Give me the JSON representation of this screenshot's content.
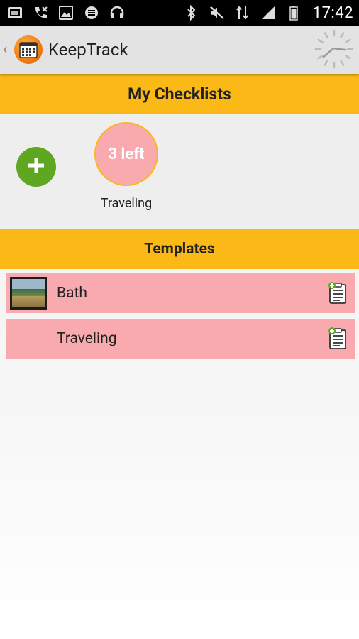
{
  "status_bar": {
    "time": "17:42",
    "icons_left": [
      "sim-icon",
      "phone-missed-icon",
      "image-icon",
      "app-icon",
      "headset-icon"
    ],
    "icons_right": [
      "bluetooth-icon",
      "mute-icon",
      "data-arrows-icon",
      "signal-icon",
      "battery-icon"
    ]
  },
  "action_bar": {
    "app_title": "KeepTrack",
    "app_icon": "calendar-icon",
    "loading": "spinner-icon"
  },
  "my_checklists": {
    "header": "My Checklists",
    "add_icon": "plus-icon",
    "items": [
      {
        "badge": "3 left",
        "name": "Traveling"
      }
    ]
  },
  "templates": {
    "header": "Templates",
    "items": [
      {
        "name": "Bath",
        "has_thumbnail": true,
        "action_icon": "add-checklist-icon"
      },
      {
        "name": "Traveling",
        "has_thumbnail": false,
        "action_icon": "add-checklist-icon"
      }
    ]
  },
  "colors": {
    "accent_yellow": "#fbb917",
    "item_pink": "#f8aaae",
    "add_green": "#5fa720",
    "app_orange": "#f07b12"
  }
}
